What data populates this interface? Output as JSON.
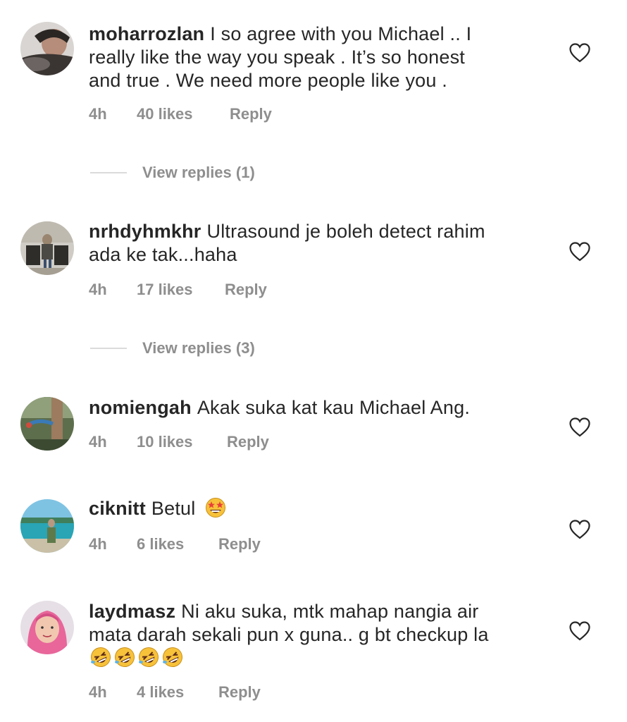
{
  "comments": [
    {
      "username": "moharrozlan",
      "text_lines": [
        "I so agree with you Michael .. I",
        "really like the way you speak . It’s so honest",
        "and true . We need more people  like you ."
      ],
      "time": "4h",
      "likes": "40 likes",
      "reply": "Reply",
      "view_replies": "View replies (1)"
    },
    {
      "username": "nrhdyhmkhr",
      "text_lines": [
        "Ultrasound je boleh detect rahim",
        "ada ke tak...haha"
      ],
      "time": "4h",
      "likes": "17 likes",
      "reply": "Reply",
      "view_replies": "View replies (3)"
    },
    {
      "username": "nomiengah",
      "text_lines": [
        "Akak suka kat kau Michael Ang."
      ],
      "time": "4h",
      "likes": "10 likes",
      "reply": "Reply"
    },
    {
      "username": "ciknitt",
      "text_lines": [
        "Betul"
      ],
      "emoji": "star-struck-emoji",
      "time": "4h",
      "likes": "6 likes",
      "reply": "Reply"
    },
    {
      "username": "laydmasz",
      "text_lines": [
        "Ni aku suka, mtk mahap nangia air",
        "mata darah sekali pun x guna.. g bt checkup la"
      ],
      "emoji": "rolling-laughing-emoji x4",
      "time": "4h",
      "likes": "4 likes",
      "reply": "Reply"
    }
  ],
  "colors": {
    "text": "#262626",
    "meta": "#8e8e8e",
    "divider": "#dbdbdb",
    "emoji": "#f7c23a"
  },
  "icons": {
    "like": "heart-outline-icon"
  }
}
